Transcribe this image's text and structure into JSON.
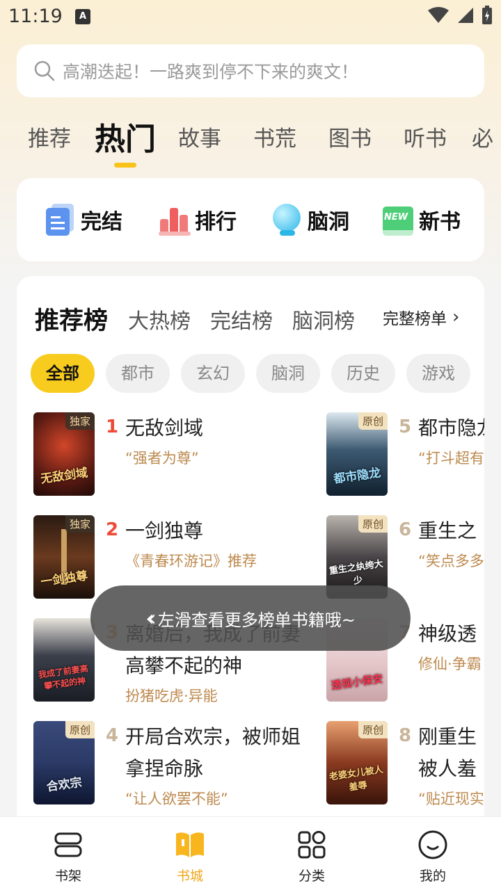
{
  "status_bar": {
    "time": "11:19",
    "a_icon": "A"
  },
  "search": {
    "placeholder": "高潮迭起！一路爽到停不下来的爽文！"
  },
  "top_tabs": [
    "推荐",
    "热门",
    "故事",
    "书荒",
    "图书",
    "听书",
    "必"
  ],
  "active_top_tab": "热门",
  "quick_entries": [
    {
      "label": "完结",
      "icon": "finished-book-icon"
    },
    {
      "label": "排行",
      "icon": "ranking-bars-icon"
    },
    {
      "label": "脑洞",
      "icon": "bubble-icon"
    },
    {
      "label": "新书",
      "icon": "new-badge-icon",
      "badge_text": "NEW"
    }
  ],
  "rank_tabs": [
    "推荐榜",
    "大热榜",
    "完结榜",
    "脑洞榜"
  ],
  "full_list_label": "完整榜单",
  "chips": [
    "全部",
    "都市",
    "玄幻",
    "脑洞",
    "历史",
    "游戏"
  ],
  "books": [
    {
      "rank": "1",
      "title": "无敌剑域",
      "sub": "“强者为尊”",
      "badge": "独家",
      "cover_text": "无敌剑域",
      "cover_color": "#5a1a12"
    },
    {
      "rank": "2",
      "title": "一剑独尊",
      "sub": "《青春环游记》推荐",
      "badge": "独家",
      "cover_text": "一剑独尊",
      "cover_color": "#3b2416"
    },
    {
      "rank": "3",
      "title": "离婚后，我成了前妻高攀不起的神",
      "sub": "扮猪吃虎·异能",
      "badge": "",
      "cover_text": "我成了前妻高攀不起的神",
      "cover_color": "#2a2f3a"
    },
    {
      "rank": "4",
      "title": "开局合欢宗，被师姐拿捏命脉",
      "sub": "“让人欲罢不能”",
      "badge": "原创",
      "cover_text": "合欢宗",
      "cover_color": "#2b3a66"
    },
    {
      "rank": "5",
      "title": "都市隐龙",
      "sub": "“打斗超有",
      "badge": "原创",
      "cover_text": "都市隐龙",
      "cover_color": "#1e3446"
    },
    {
      "rank": "6",
      "title": "重生之",
      "sub": "“笑点多多",
      "badge": "原创",
      "cover_text": "重生之纨绔大少",
      "cover_color": "#2c2a2d"
    },
    {
      "rank": "7",
      "title": "神级透",
      "sub": "修仙·争霸",
      "badge": "",
      "cover_text": "透视小保安",
      "cover_color": "#e9d6d6"
    },
    {
      "rank": "8",
      "title": "刚重生被人羞",
      "sub": "“贴近现实",
      "badge": "原创",
      "cover_text": "老婆女儿被人羞辱",
      "cover_color": "#6a2a18"
    }
  ],
  "toast": {
    "text": "左滑查看更多榜单书籍哦~"
  },
  "bottom_nav": [
    {
      "label": "书架",
      "icon": "bookshelf-icon"
    },
    {
      "label": "书城",
      "icon": "open-book-icon"
    },
    {
      "label": "分类",
      "icon": "grid-icon"
    },
    {
      "label": "我的",
      "icon": "smile-icon"
    }
  ],
  "active_bottom_nav": "书城",
  "colors": {
    "accent": "#f8c21b",
    "rank_red": "#ef4a37",
    "sub_text": "#bd8a4f"
  }
}
